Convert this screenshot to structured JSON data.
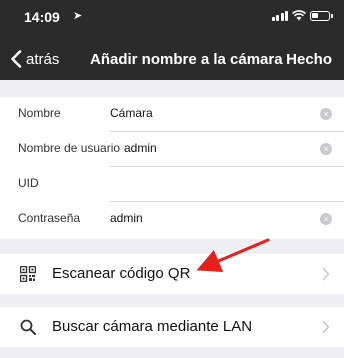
{
  "status_bar": {
    "time": "14:09",
    "location_indicator": "➤",
    "battery_level": 0.4
  },
  "nav": {
    "back_label": "atrás",
    "title": "Añadir nombre a la cámara",
    "done_label": "Hecho"
  },
  "form": {
    "fields": [
      {
        "label": "Nombre",
        "value": "Cámara"
      },
      {
        "label": "Nombre de usuario",
        "value": "admin"
      },
      {
        "label": "UID",
        "value": ""
      },
      {
        "label": "Contraseña",
        "value": "admin"
      }
    ]
  },
  "actions": [
    {
      "label": "Escanear código QR",
      "icon": "qr-code-icon"
    },
    {
      "label": "Buscar cámara mediante LAN",
      "icon": "search-icon"
    }
  ],
  "colors": {
    "nav_background": "#2b2b2b",
    "page_background": "#efeff4",
    "annotation_arrow": "#e8201c"
  }
}
